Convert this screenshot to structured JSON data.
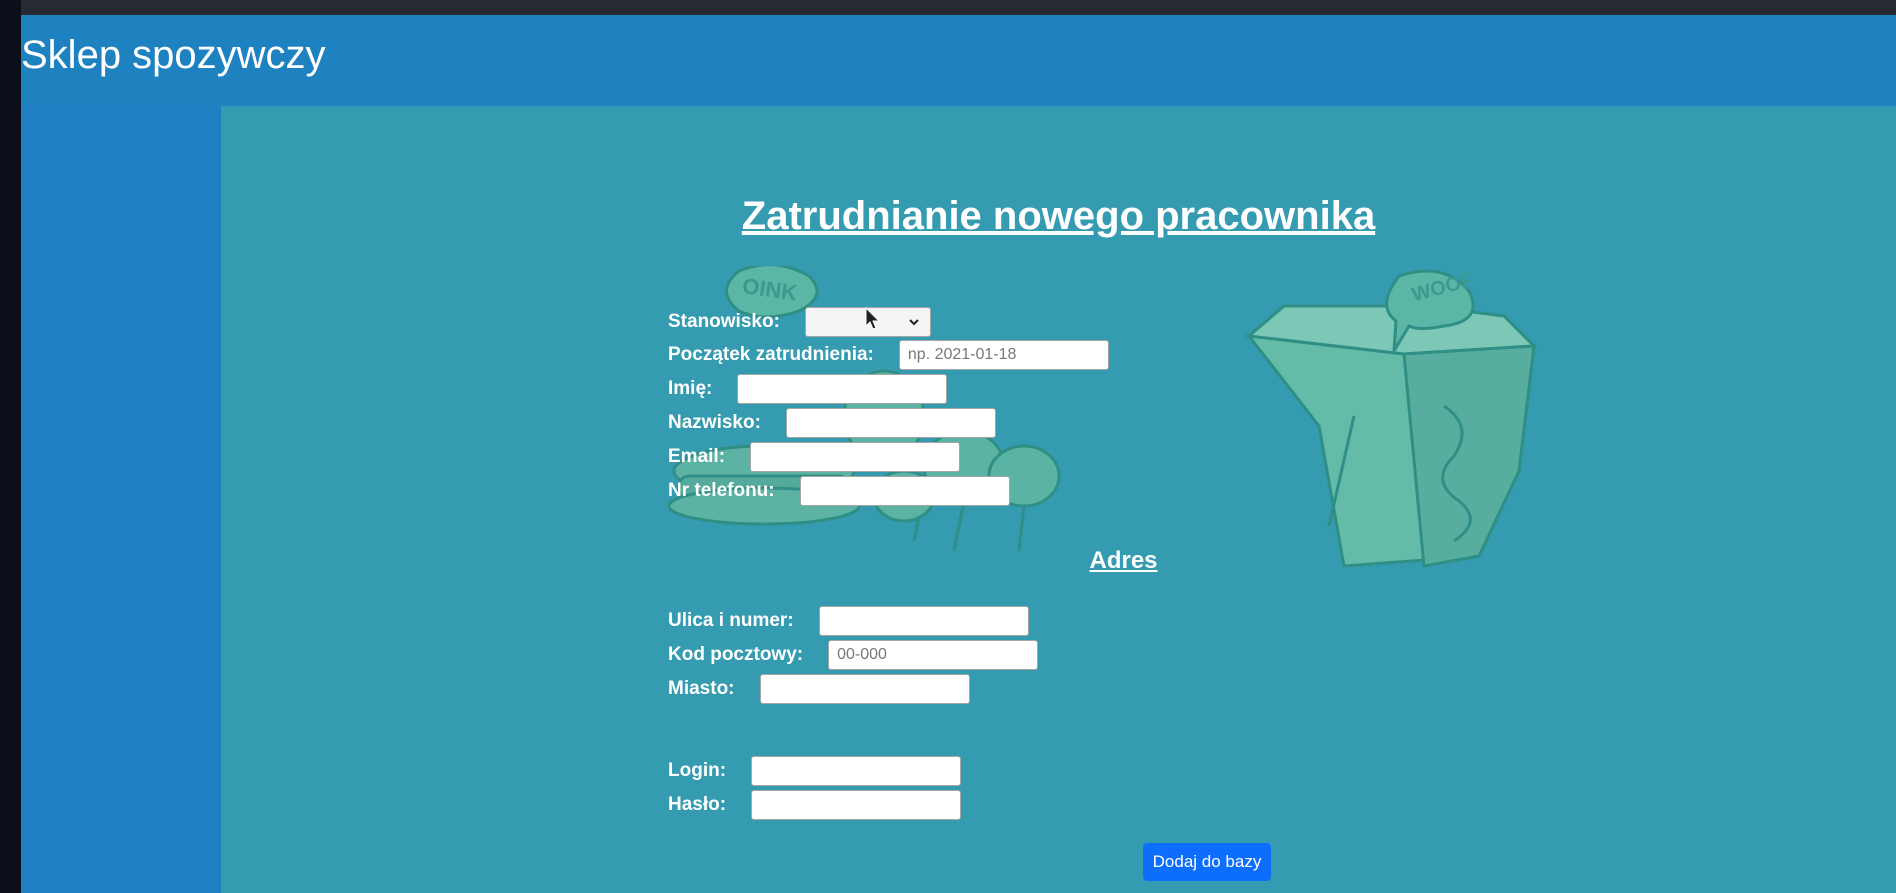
{
  "header": {
    "title": "Sklep spozywczy"
  },
  "form": {
    "title": "Zatrudnianie nowego pracownika",
    "stanowisko": {
      "label": "Stanowisko:",
      "value": ""
    },
    "poczatek": {
      "label": "Początek zatrudnienia:",
      "placeholder": "np. 2021-01-18",
      "value": ""
    },
    "imie": {
      "label": "Imię:",
      "value": ""
    },
    "nazwisko": {
      "label": "Nazwisko:",
      "value": ""
    },
    "email": {
      "label": "Email:",
      "value": ""
    },
    "telefon": {
      "label": "Nr telefonu:",
      "value": ""
    },
    "address_heading": "Adres",
    "ulica": {
      "label": "Ulica i numer:",
      "value": ""
    },
    "kod": {
      "label": "Kod pocztowy:",
      "placeholder": "00-000",
      "value": ""
    },
    "miasto": {
      "label": "Miasto:",
      "value": ""
    },
    "login": {
      "label": "Login:",
      "value": ""
    },
    "haslo": {
      "label": "Hasło:",
      "value": ""
    },
    "submit_label": "Dodaj do bazy",
    "sticker_texts": [
      "OINK",
      "WOOF"
    ]
  },
  "colors": {
    "header_bg": "#1f82c0",
    "content_bg": "#359bb0",
    "button_bg": "#0d6efd",
    "art": "#5db8a8"
  },
  "icons": [
    "chevron-down-icon",
    "mouse-cursor-icon",
    "food-illustration"
  ]
}
